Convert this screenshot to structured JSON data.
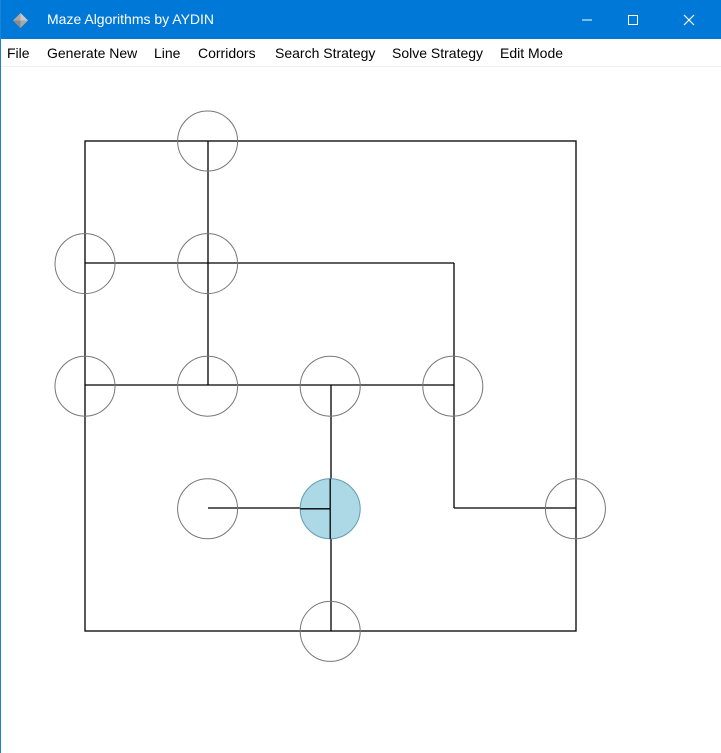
{
  "window": {
    "title": "Maze Algorithms by AYDIN",
    "icon": "diamond-app-icon",
    "controls": [
      "minimize-icon",
      "maximize-icon",
      "close-icon"
    ]
  },
  "menu": {
    "items": [
      {
        "label": "File"
      },
      {
        "label": "Generate New"
      },
      {
        "label": "Line"
      },
      {
        "label": "Corridors"
      },
      {
        "label": "Search Strategy"
      },
      {
        "label": "Solve Strategy"
      },
      {
        "label": "Edit Mode"
      }
    ]
  },
  "maze": {
    "grid_size": 5,
    "nodes": [
      {
        "row": 0,
        "col": 1
      },
      {
        "row": 1,
        "col": 0
      },
      {
        "row": 1,
        "col": 1
      },
      {
        "row": 2,
        "col": 0
      },
      {
        "row": 2,
        "col": 1
      },
      {
        "row": 2,
        "col": 2
      },
      {
        "row": 2,
        "col": 3
      },
      {
        "row": 3,
        "col": 1
      },
      {
        "row": 3,
        "col": 2,
        "selected": true
      },
      {
        "row": 3,
        "col": 4
      },
      {
        "row": 4,
        "col": 2
      }
    ],
    "colors": {
      "line": "#000000",
      "node_stroke": "#777777",
      "selected_fill": "#add8e6",
      "title_bar": "#0078d7"
    }
  }
}
